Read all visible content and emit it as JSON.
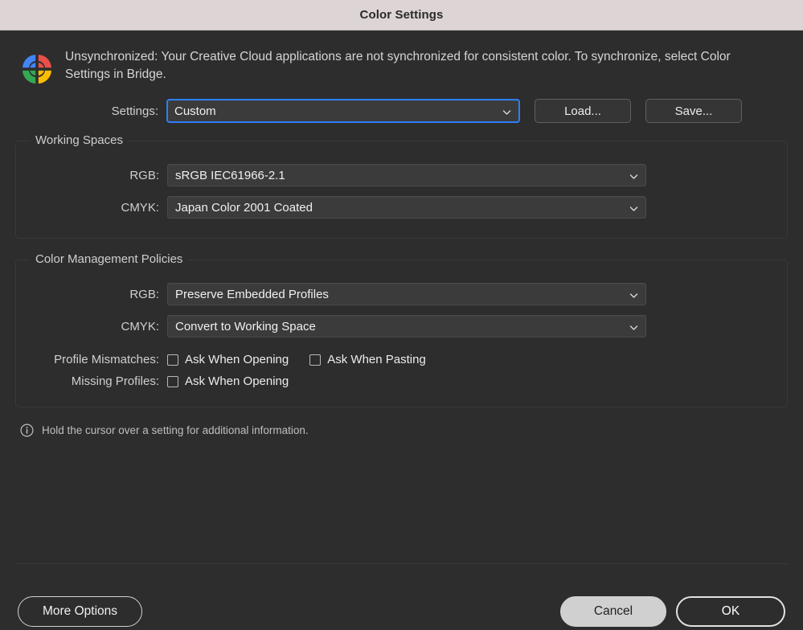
{
  "window": {
    "title": "Color Settings"
  },
  "warning": {
    "icon": "creative-cloud-sync-icon",
    "message": "Unsynchronized: Your Creative Cloud applications are not synchronized for consistent color. To synchronize, select Color Settings in Bridge."
  },
  "settings": {
    "label": "Settings:",
    "value": "Custom",
    "load_label": "Load...",
    "save_label": "Save..."
  },
  "working_spaces": {
    "title": "Working Spaces",
    "rows": [
      {
        "label": "RGB:",
        "value": "sRGB IEC61966-2.1"
      },
      {
        "label": "CMYK:",
        "value": "Japan Color 2001 Coated"
      }
    ]
  },
  "policies": {
    "title": "Color Management Policies",
    "rows": [
      {
        "label": "RGB:",
        "value": "Preserve Embedded Profiles"
      },
      {
        "label": "CMYK:",
        "value": "Convert to Working Space"
      }
    ],
    "profile_mismatches": {
      "label": "Profile Mismatches:",
      "options": [
        {
          "text": "Ask When Opening",
          "checked": false
        },
        {
          "text": "Ask When Pasting",
          "checked": false
        }
      ]
    },
    "missing_profiles": {
      "label": "Missing Profiles:",
      "options": [
        {
          "text": "Ask When Opening",
          "checked": false
        }
      ]
    }
  },
  "hint": {
    "icon": "info-icon",
    "text": "Hold the cursor over a setting for additional information."
  },
  "footer": {
    "more_options_label": "More Options",
    "cancel_label": "Cancel",
    "ok_label": "OK"
  },
  "colors": {
    "dialog_background": "#2d2d2d",
    "titlebar_background": "#ddd5d5",
    "focus_ring": "#2d7ff9",
    "cancel_button": "#d0d0d0",
    "icon_blue": "#4285f4",
    "icon_red": "#ea4f4a",
    "icon_green": "#34a853",
    "icon_yellow": "#fbbc05"
  }
}
